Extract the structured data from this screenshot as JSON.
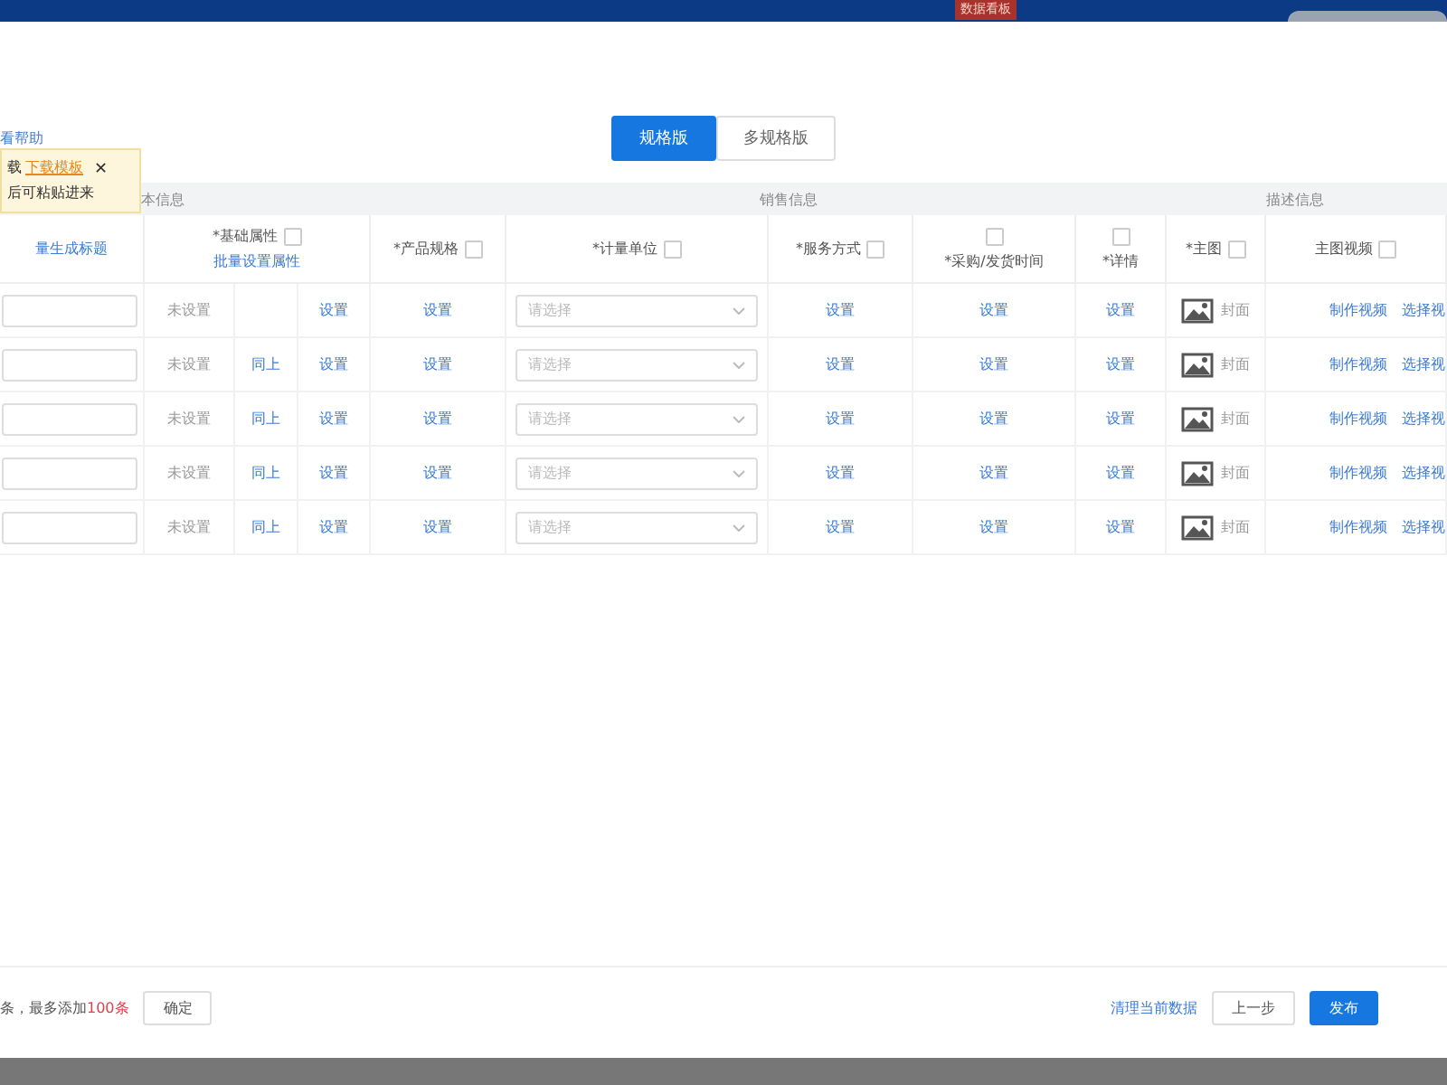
{
  "top_bar": {
    "badge": "数据看板"
  },
  "help_link": "看帮助",
  "tooltip": {
    "prefix": "载",
    "link": "下载模板",
    "close": "✕",
    "line2": "后可粘贴进来"
  },
  "tabs": [
    {
      "label": "规格版",
      "selected": true
    },
    {
      "label": "多规格版",
      "selected": false
    }
  ],
  "groups": [
    {
      "label": "本信息"
    },
    {
      "label": "销售信息"
    },
    {
      "label": "描述信息"
    }
  ],
  "columns": [
    {
      "kind": "link",
      "label": "量生成标题"
    },
    {
      "kind": "attr",
      "label": "*基础属性",
      "checked": false,
      "link": "批量设置属性"
    },
    {
      "kind": "check",
      "label": "*产品规格",
      "checked": false
    },
    {
      "kind": "check",
      "label": "*计量单位",
      "checked": false
    },
    {
      "kind": "check",
      "label": "*服务方式",
      "checked": false
    },
    {
      "kind": "checktop",
      "label": "*采购/发货时间",
      "checked": false
    },
    {
      "kind": "checktop",
      "label": "*详情",
      "checked": false
    },
    {
      "kind": "check",
      "label": "*主图",
      "checked": false
    },
    {
      "kind": "check",
      "label": "主图视频",
      "checked": false
    }
  ],
  "rows": [
    {
      "status": "未设置",
      "copy": null,
      "attr": "设置",
      "spec": "设置",
      "unit": "请选择",
      "service": "设置",
      "time": "设置",
      "detail": "设置",
      "image": "封面",
      "make": "制作视频",
      "pick": "选择视"
    },
    {
      "status": "未设置",
      "copy": "同上",
      "attr": "设置",
      "spec": "设置",
      "unit": "请选择",
      "service": "设置",
      "time": "设置",
      "detail": "设置",
      "image": "封面",
      "make": "制作视频",
      "pick": "选择视"
    },
    {
      "status": "未设置",
      "copy": "同上",
      "attr": "设置",
      "spec": "设置",
      "unit": "请选择",
      "service": "设置",
      "time": "设置",
      "detail": "设置",
      "image": "封面",
      "make": "制作视频",
      "pick": "选择视"
    },
    {
      "status": "未设置",
      "copy": "同上",
      "attr": "设置",
      "spec": "设置",
      "unit": "请选择",
      "service": "设置",
      "time": "设置",
      "detail": "设置",
      "image": "封面",
      "make": "制作视频",
      "pick": "选择视"
    },
    {
      "status": "未设置",
      "copy": "同上",
      "attr": "设置",
      "spec": "设置",
      "unit": "请选择",
      "service": "设置",
      "time": "设置",
      "detail": "设置",
      "image": "封面",
      "make": "制作视频",
      "pick": "选择视"
    }
  ],
  "footer": {
    "note": "条，最多添加",
    "limit": "100条",
    "confirm": "确定",
    "clear": "清理当前数据",
    "prev": "上一步",
    "publish": "发布"
  }
}
